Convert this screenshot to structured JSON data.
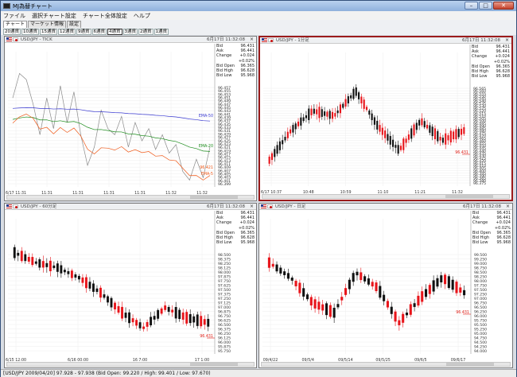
{
  "window": {
    "title": "MJ為替チャート",
    "minimize": "–",
    "maximize": "□",
    "close": "✕"
  },
  "menu": [
    "ファイル",
    "選択チャート設定",
    "チャート全体設定",
    "ヘルプ"
  ],
  "tabs": [
    "チャート",
    "マーケット情報",
    "設定"
  ],
  "timeframes": [
    "20通貨",
    "10通貨",
    "15通貨",
    "12通貨",
    "9通貨",
    "6通貨",
    "4通貨",
    "3通貨",
    "2通貨",
    "1通貨"
  ],
  "active_timeframe_index": 6,
  "colors": {
    "up": "#e8141a",
    "down": "#111111",
    "ema_blue": "#3b3bd1",
    "ema_green": "#1c8c1c",
    "ema_orange": "#ef5a1a",
    "gray": "#8a8a8a",
    "price_marker": "#e0221a"
  },
  "status": "[USD/JPY 2009/04/20] 97.928 - 97.938 (Bid Open: 99.220 / High: 99.401 / Low: 97.670)",
  "panels": [
    {
      "symbol": "USD/JPY - TICK",
      "time": "6月17日 11:32:08",
      "close": "×",
      "info": [
        [
          "Bid",
          "96.431"
        ],
        [
          "Ask",
          "96.441"
        ],
        [
          "Change",
          "+0.024"
        ],
        [
          "",
          "+0.02%"
        ],
        [
          "Bid Open",
          "96.365"
        ],
        [
          "Bid High",
          "96.628"
        ],
        [
          "Bid Low",
          "95.968"
        ]
      ],
      "yticks": [
        "96.457",
        "96.455",
        "96.453",
        "96.451",
        "96.449",
        "96.447",
        "96.445",
        "96.443",
        "96.441",
        "96.439",
        "96.437",
        "96.435",
        "96.433",
        "96.431",
        "96.429",
        "96.427",
        "96.425",
        "96.423",
        "96.421",
        "96.419",
        "96.417",
        "96.415",
        "96.413",
        "96.411",
        "96.409",
        "96.407",
        "96.405",
        "96.403",
        "96.401",
        "96.399"
      ],
      "xticks": [
        "6/17 11:31",
        "11:31",
        "11:31",
        "11:31",
        "11:31",
        "11:32",
        "11:32"
      ],
      "ema_labels": [
        {
          "name": "EMA-50",
          "color": "#3b3bd1"
        },
        {
          "name": "EMA-20",
          "color": "#1c8c1c"
        },
        {
          "name": "EMA-5",
          "color": "#ef5a1a"
        }
      ],
      "price_marker": "96.421"
    },
    {
      "symbol": "USD/JPY - 1分足",
      "time": "6月17日 11:32:08",
      "close": "×",
      "info": [
        [
          "Bid",
          "96.431"
        ],
        [
          "Ask",
          "96.441"
        ],
        [
          "Change",
          "+0.024"
        ],
        [
          "",
          "+0.02%"
        ],
        [
          "Bid Open",
          "96.365"
        ],
        [
          "Bid High",
          "96.628"
        ],
        [
          "Bid Low",
          "95.968"
        ]
      ],
      "yticks": [
        "96.565",
        "96.560",
        "96.555",
        "96.550",
        "96.545",
        "96.540",
        "96.535",
        "96.530",
        "96.525",
        "96.520",
        "96.515",
        "96.510",
        "96.505",
        "96.500",
        "96.495",
        "96.490",
        "96.485",
        "96.480",
        "96.475",
        "96.470",
        "96.465",
        "96.460",
        "96.455",
        "96.450",
        "96.445",
        "96.440",
        "96.435",
        "96.430",
        "96.425",
        "96.420",
        "96.415",
        "96.410",
        "96.405",
        "96.400",
        "96.395",
        "96.390",
        "96.385",
        "96.380",
        "96.375"
      ],
      "xticks": [
        "6/17 10:37",
        "10:48",
        "10:59",
        "11:10",
        "11:21",
        "11:32"
      ],
      "price_marker": "96.431"
    },
    {
      "symbol": "USD/JPY - 60分足",
      "time": "6月17日 11:32:08",
      "close": "×",
      "info": [
        [
          "Bid",
          "96.431"
        ],
        [
          "Ask",
          "96.441"
        ],
        [
          "Change",
          "+0.024"
        ],
        [
          "",
          "+0.02%"
        ],
        [
          "Bid Open",
          "96.365"
        ],
        [
          "Bid High",
          "96.628"
        ],
        [
          "Bid Low",
          "95.968"
        ]
      ],
      "yticks": [
        "98.500",
        "98.375",
        "98.250",
        "98.125",
        "98.000",
        "97.875",
        "97.750",
        "97.625",
        "97.500",
        "97.375",
        "97.250",
        "97.125",
        "97.000",
        "96.875",
        "96.750",
        "96.625",
        "96.500",
        "96.375",
        "96.250",
        "96.125",
        "96.000",
        "95.875",
        "95.750"
      ],
      "xticks": [
        "6/15 12:00",
        "6/16 00:00",
        "16 7:00",
        "17 1:00"
      ],
      "price_marker": "96.431"
    },
    {
      "symbol": "USD/JPY - 日足",
      "time": "6月17日 11:32:08",
      "close": "×",
      "info": [
        [
          "Bid",
          "96.431"
        ],
        [
          "Ask",
          "96.441"
        ],
        [
          "Change",
          "+0.024"
        ],
        [
          "",
          "+0.02%"
        ],
        [
          "Bid Open",
          "96.365"
        ],
        [
          "Bid High",
          "96.628"
        ],
        [
          "Bid Low",
          "95.968"
        ]
      ],
      "yticks": [
        "99.500",
        "99.250",
        "99.000",
        "98.750",
        "98.500",
        "98.250",
        "98.000",
        "97.750",
        "97.500",
        "97.250",
        "97.000",
        "96.750",
        "96.500",
        "96.250",
        "96.000",
        "95.750",
        "95.500",
        "95.250",
        "95.000",
        "94.750",
        "94.500",
        "94.250",
        "94.000"
      ],
      "xticks": [
        "09/4/22",
        "09/5/4",
        "09/5/14",
        "09/5/25",
        "09/6/5",
        "09/6/17"
      ],
      "price_marker": "96.431"
    }
  ]
}
